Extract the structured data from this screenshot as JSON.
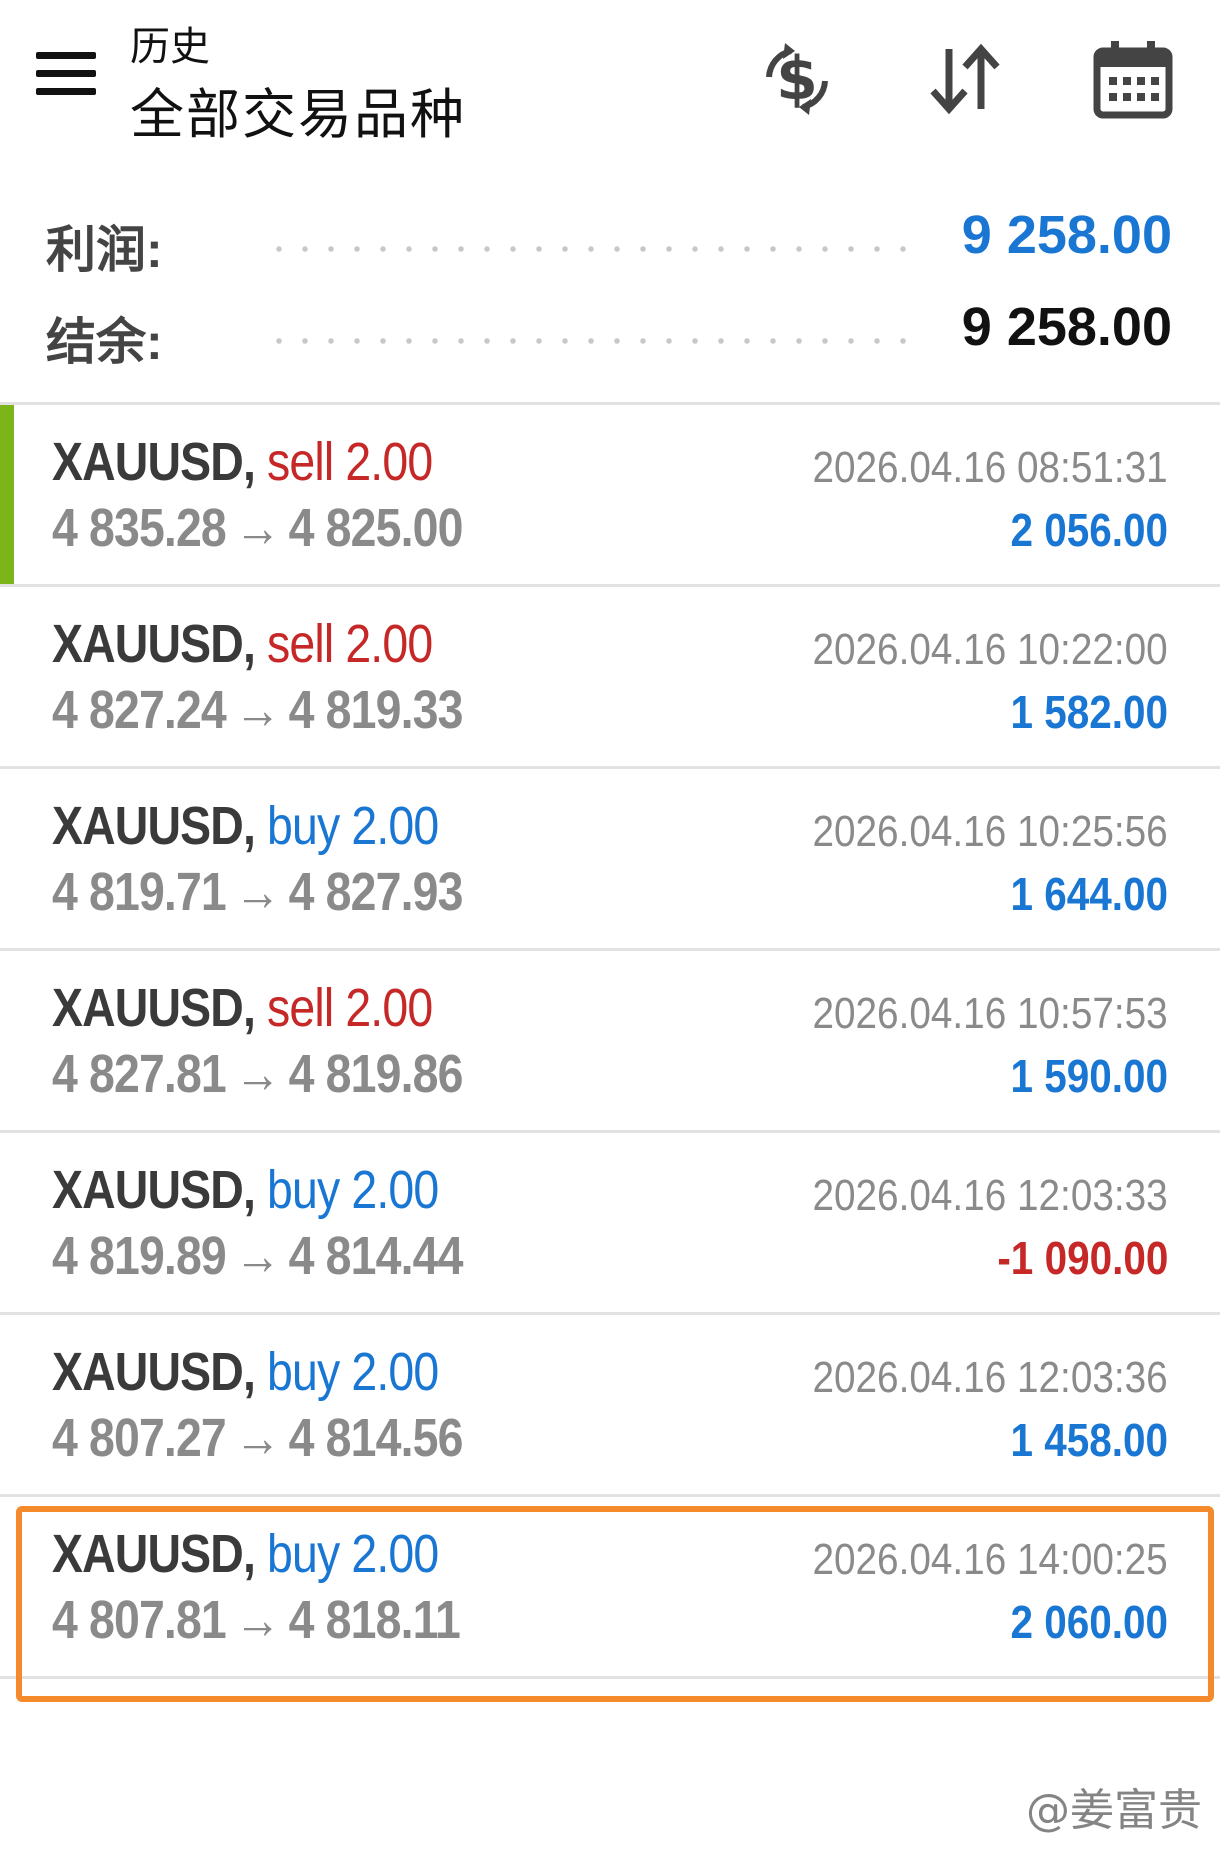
{
  "header": {
    "subtitle": "历史",
    "title": "全部交易品种",
    "icons": [
      "menu-icon",
      "currency-exchange-icon",
      "sort-icon",
      "calendar-icon"
    ]
  },
  "summary": {
    "profit_label": "利润:",
    "profit_value": "9 258.00",
    "balance_label": "结余:",
    "balance_value": "9 258.00"
  },
  "colors": {
    "sell": "#c62828",
    "buy": "#1976d2",
    "positive": "#1976d2",
    "negative": "#c62828",
    "accent": "#7cb518",
    "highlight": "#f58a2c"
  },
  "deals": [
    {
      "symbol": "XAUUSD",
      "type": "sell",
      "volume": "2.00",
      "open": "4 835.28",
      "close": "4 825.00",
      "time": "2026.04.16 08:51:31",
      "profit": "2 056.00",
      "negative": false
    },
    {
      "symbol": "XAUUSD",
      "type": "sell",
      "volume": "2.00",
      "open": "4 827.24",
      "close": "4 819.33",
      "time": "2026.04.16 10:22:00",
      "profit": "1 582.00",
      "negative": false
    },
    {
      "symbol": "XAUUSD",
      "type": "buy",
      "volume": "2.00",
      "open": "4 819.71",
      "close": "4 827.93",
      "time": "2026.04.16 10:25:56",
      "profit": "1 644.00",
      "negative": false
    },
    {
      "symbol": "XAUUSD",
      "type": "sell",
      "volume": "2.00",
      "open": "4 827.81",
      "close": "4 819.86",
      "time": "2026.04.16 10:57:53",
      "profit": "1 590.00",
      "negative": false
    },
    {
      "symbol": "XAUUSD",
      "type": "buy",
      "volume": "2.00",
      "open": "4 819.89",
      "close": "4 814.44",
      "time": "2026.04.16 12:03:33",
      "profit": "-1 090.00",
      "negative": true
    },
    {
      "symbol": "XAUUSD",
      "type": "buy",
      "volume": "2.00",
      "open": "4 807.27",
      "close": "4 814.56",
      "time": "2026.04.16 12:03:36",
      "profit": "1 458.00",
      "negative": false
    },
    {
      "symbol": "XAUUSD",
      "type": "buy",
      "volume": "2.00",
      "open": "4 807.81",
      "close": "4 818.11",
      "time": "2026.04.16 14:00:25",
      "profit": "2 060.00",
      "negative": false
    }
  ],
  "watermark": "@姜富贵"
}
